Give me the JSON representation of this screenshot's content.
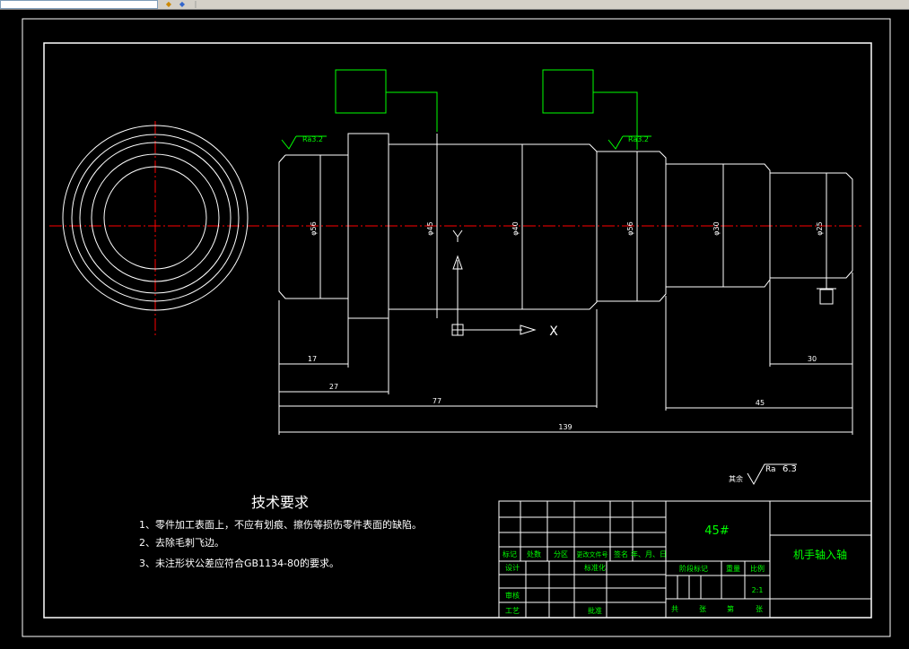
{
  "toolbar": {
    "input_value": "",
    "icon_1": "layer-icon",
    "icon_2": "properties-icon"
  },
  "colors": {
    "background": "#000000",
    "line": "#ffffff",
    "centerline": "#ff0000",
    "annotation": "#00ff00",
    "title_text": "#00ff00"
  },
  "dims": {
    "d1": "17",
    "d2": "27",
    "d3": "77",
    "d4": "139",
    "d5": "45",
    "d6": "30",
    "dia1": "φ56",
    "dia2": "φ45",
    "dia3": "φ40",
    "dia4": "φ56",
    "dia5": "φ30",
    "dia6": "φ25"
  },
  "surface": {
    "ra1": "Ra3.2",
    "ra2": "Ra3.2",
    "rest_label": "其余",
    "rest_ra": "Ra",
    "rest_val": "6.3"
  },
  "ucs": {
    "y_label": "Y",
    "x_label": "X"
  },
  "notes": {
    "title": "技术要求",
    "items": [
      "1、零件加工表面上，不应有划痕、擦伤等损伤零件表面的缺陷。",
      "2、去除毛刺飞边。",
      "3、未注形状公差应符合GB1134-80的要求。"
    ]
  },
  "title_block": {
    "material": "45#",
    "part_name": "机手轴入轴",
    "scale": "2:1",
    "row_labels": [
      "标记",
      "处数",
      "分区",
      "更改文件号",
      "签名",
      "年、月、日"
    ],
    "design": "设计",
    "standardize": "标准化",
    "review": "审核",
    "process": "工艺",
    "approve": "批准",
    "stage_mark": "阶段标记",
    "weight": "重量",
    "ratio": "比例",
    "total": "共",
    "sheet_unit": "张",
    "page": "第",
    "page_unit": "张"
  }
}
